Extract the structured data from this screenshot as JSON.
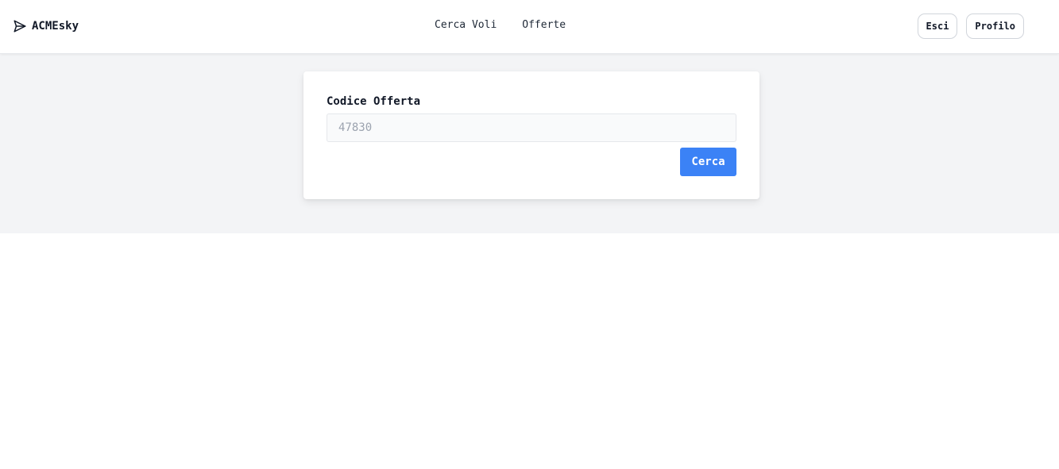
{
  "brand": {
    "name": "ACMEsky",
    "icon": "paper-plane-icon"
  },
  "nav": {
    "links": [
      {
        "label": "Cerca Voli"
      },
      {
        "label": "Offerte"
      }
    ]
  },
  "actions": {
    "logout_label": "Esci",
    "profile_label": "Profilo"
  },
  "form": {
    "label": "Codice Offerta",
    "input_value": "",
    "input_placeholder": "47830",
    "submit_label": "Cerca"
  },
  "colors": {
    "primary": "#3b82f6",
    "band_background": "#f3f4f6",
    "card_background": "#ffffff"
  }
}
